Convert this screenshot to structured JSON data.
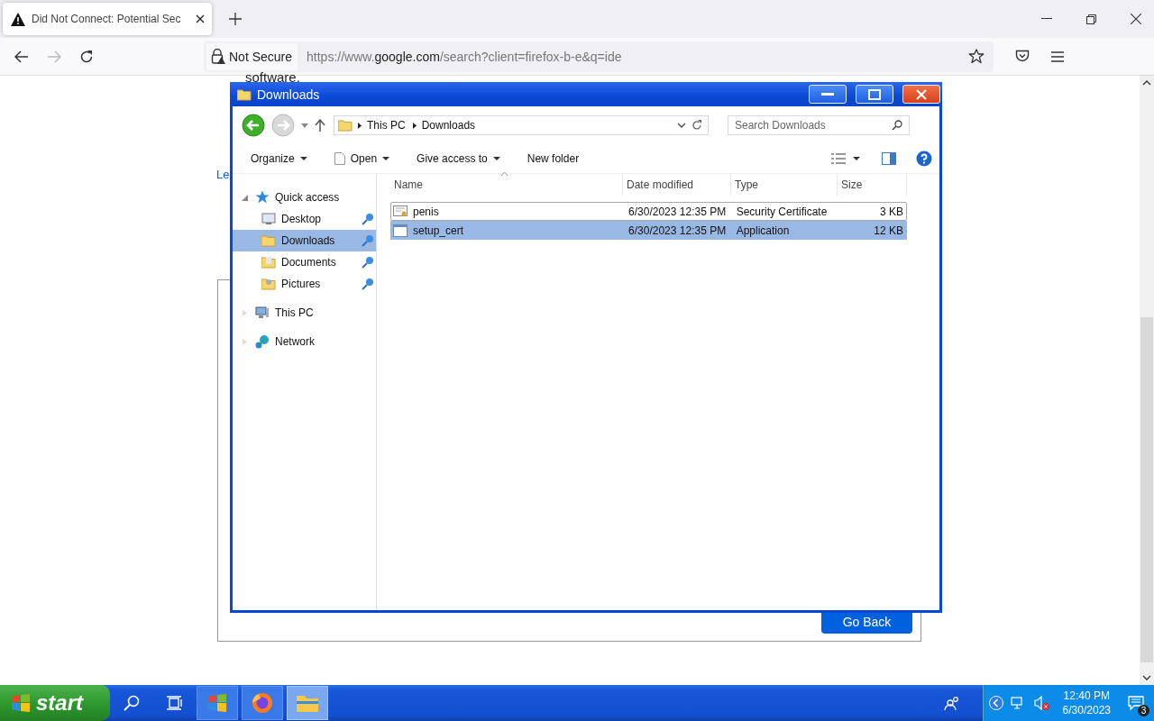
{
  "browser": {
    "tab": {
      "title": "Did Not Connect: Potential Sec",
      "selected": true
    },
    "address": {
      "security_label": "Not Secure",
      "url_prefix": "https://www.",
      "url_domain": "google.com",
      "url_rest": "/search?client=firefox-b-e&q=ide"
    }
  },
  "page": {
    "text_fragment": "software.",
    "link_fragment": "Le",
    "button": "Go Back"
  },
  "explorer": {
    "title": "Downloads",
    "breadcrumb": [
      "This PC",
      "Downloads"
    ],
    "search_placeholder": "Search Downloads",
    "toolbar": [
      {
        "label": "Organize",
        "kind": "menu"
      },
      {
        "label": "Open",
        "kind": "document-menu"
      },
      {
        "label": "Give access to",
        "kind": "menu"
      },
      {
        "label": "New folder",
        "kind": "command"
      }
    ],
    "nav": [
      {
        "label": "Quick access",
        "kind": "star",
        "expanded": true,
        "children": [
          {
            "label": "Desktop",
            "kind": "desktop",
            "pinned": true,
            "selected": false
          },
          {
            "label": "Downloads",
            "kind": "downloads",
            "pinned": true,
            "selected": true
          },
          {
            "label": "Documents",
            "kind": "documents",
            "pinned": true,
            "selected": false
          },
          {
            "label": "Pictures",
            "kind": "pictures",
            "pinned": true,
            "selected": false
          }
        ]
      },
      {
        "label": "This PC",
        "kind": "computer",
        "expanded": false
      },
      {
        "label": "Network",
        "kind": "network",
        "expanded": false
      }
    ],
    "columns": [
      "Name",
      "Date modified",
      "Type",
      "Size"
    ],
    "files": [
      {
        "name": "penis",
        "date": "6/30/2023 12:35 PM",
        "type": "Security Certificate",
        "size": "3 KB",
        "kind": "certificate",
        "selected": false,
        "hovered": true
      },
      {
        "name": "setup_cert",
        "date": "6/30/2023 12:35 PM",
        "type": "Application",
        "size": "12 KB",
        "kind": "application",
        "selected": true,
        "hovered": false
      }
    ]
  },
  "taskbar": {
    "start": "start",
    "apps": [
      {
        "kind": "windows",
        "selected": false
      },
      {
        "kind": "firefox",
        "selected": false
      },
      {
        "kind": "explorer",
        "selected": true
      }
    ],
    "time": "12:40 PM",
    "date": "6/30/2023",
    "notifications": "3"
  }
}
